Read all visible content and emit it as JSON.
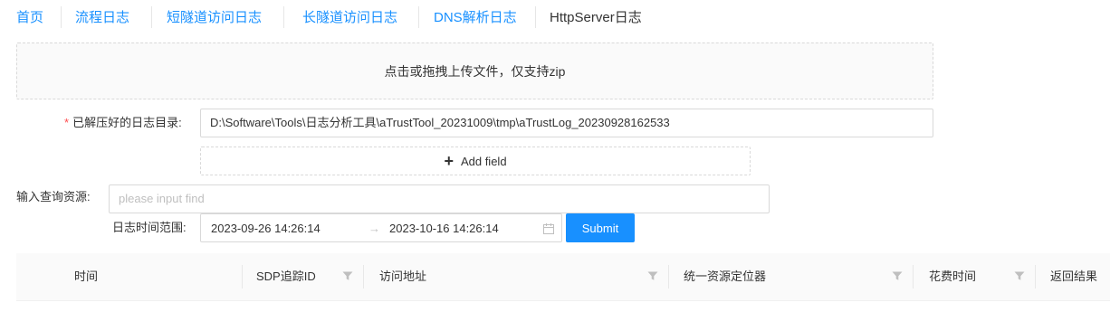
{
  "nav": {
    "items": [
      {
        "label": "首页"
      },
      {
        "label": "流程日志"
      },
      {
        "label": "短隧道访问日志"
      },
      {
        "label": "长隧道访问日志"
      },
      {
        "label": "DNS解析日志"
      },
      {
        "label": "HttpServer日志"
      }
    ]
  },
  "upload": {
    "text": "点击或拖拽上传文件，仅支持zip"
  },
  "form": {
    "required_mark": "*",
    "dir_label": "已解压好的日志目录:",
    "dir_value": "D:\\Software\\Tools\\日志分析工具\\aTrustTool_20231009\\tmp\\aTrustLog_20230928162533",
    "add_field": "Add field",
    "query_label": "输入查询资源:",
    "query_placeholder": "please input find",
    "range_label": "日志时间范围:",
    "range_start": "2023-09-26 14:26:14",
    "range_arrow": "→",
    "range_end": "2023-10-16 14:26:14",
    "submit": "Submit"
  },
  "table": {
    "columns": [
      {
        "label": "时间"
      },
      {
        "label": "SDP追踪ID"
      },
      {
        "label": "访问地址"
      },
      {
        "label": "统一资源定位器"
      },
      {
        "label": "花费时间"
      },
      {
        "label": "返回结果"
      }
    ]
  },
  "colors": {
    "accent": "#1890ff",
    "required": "#ff4d4f",
    "border": "#d9d9d9"
  }
}
